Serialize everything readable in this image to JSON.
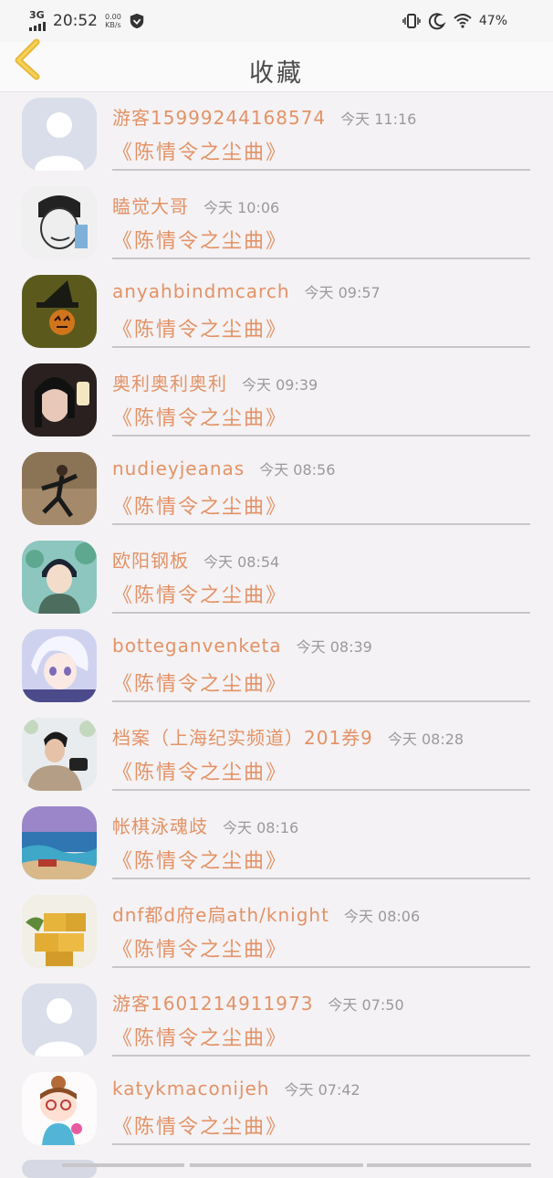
{
  "status_bar": {
    "network": "3G",
    "time": "20:52",
    "speed_value": "0.00",
    "speed_unit": "KB/s",
    "battery": "47%"
  },
  "header": {
    "title": "收藏"
  },
  "list": {
    "items": [
      {
        "name": "游客15999244168574",
        "time": "今天 11:16",
        "drama": "《陈情令之尘曲》",
        "avatar": "default-avatar"
      },
      {
        "name": "瞌觉大哥",
        "time": "今天 10:06",
        "drama": "《陈情令之尘曲》",
        "avatar": "meme-avatar"
      },
      {
        "name": "anyahbindmcarch",
        "time": "今天 09:57",
        "drama": "《陈情令之尘曲》",
        "avatar": "pumpkin-avatar"
      },
      {
        "name": "奥利奥利奥利",
        "time": "今天 09:39",
        "drama": "《陈情令之尘曲》",
        "avatar": "girl-avatar"
      },
      {
        "name": "nudieyjeanas",
        "time": "今天 08:56",
        "drama": "《陈情令之尘曲》",
        "avatar": "dancer-avatar"
      },
      {
        "name": "欧阳钢板",
        "time": "今天 08:54",
        "drama": "《陈情令之尘曲》",
        "avatar": "anime-boy-avatar"
      },
      {
        "name": "botteganvenketa",
        "time": "今天 08:39",
        "drama": "《陈情令之尘曲》",
        "avatar": "anime-white-hair-avatar"
      },
      {
        "name": "档案（上海纪实频道）201券9",
        "time": "今天 08:28",
        "drama": "《陈情令之尘曲》",
        "avatar": "photographer-avatar"
      },
      {
        "name": "帐棋泳魂歧",
        "time": "今天 08:16",
        "drama": "《陈情令之尘曲》",
        "avatar": "sea-avatar"
      },
      {
        "name": "dnf都d府e扃ath/knight",
        "time": "今天 08:06",
        "drama": "《陈情令之尘曲》",
        "avatar": "cake-avatar"
      },
      {
        "name": "游客1601214911973",
        "time": "今天 07:50",
        "drama": "《陈情令之尘曲》",
        "avatar": "default-avatar"
      },
      {
        "name": "katykmaconijeh",
        "time": "今天 07:42",
        "drama": "《陈情令之尘曲》",
        "avatar": "cartoon-girl-avatar"
      }
    ]
  },
  "colors": {
    "accent": "#e39266",
    "back_arrow": "#e8b73a",
    "background": "#f4f2f4"
  }
}
